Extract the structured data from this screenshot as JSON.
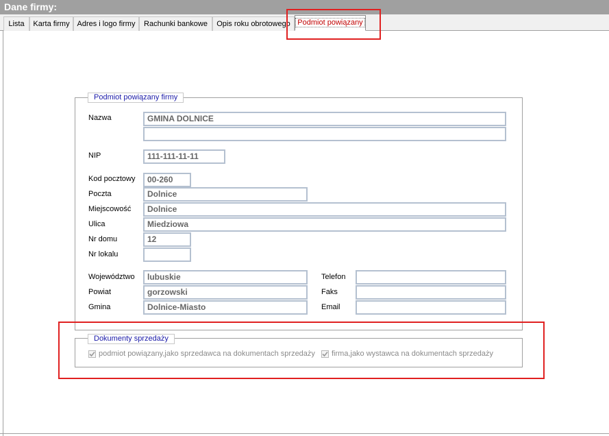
{
  "window": {
    "title": "Dane firmy:"
  },
  "tabs": [
    {
      "label": "Lista"
    },
    {
      "label": "Karta firmy"
    },
    {
      "label": "Adres i logo firmy"
    },
    {
      "label": "Rachunki bankowe"
    },
    {
      "label": "Opis roku obrotowego"
    },
    {
      "label": "Podmiot powiązany",
      "active": true
    }
  ],
  "podmiot": {
    "legend": "Podmiot powiązany firmy",
    "nazwa_label": "Nazwa",
    "nazwa_value": "GMINA DOLNICE",
    "nazwa_value2": "",
    "nip_label": "NIP",
    "nip_value": "111-111-11-11",
    "kod_label": "Kod pocztowy",
    "kod_value": "00-260",
    "poczta_label": "Poczta",
    "poczta_value": "Dolnice",
    "miejscowosc_label": "Miejscowość",
    "miejscowosc_value": "Dolnice",
    "ulica_label": "Ulica",
    "ulica_value": "Miedziowa",
    "nrdomu_label": "Nr domu",
    "nrdomu_value": "12",
    "nrlokalu_label": "Nr lokalu",
    "nrlokalu_value": "",
    "wojewodztwo_label": "Województwo",
    "wojewodztwo_value": "lubuskie",
    "powiat_label": "Powiat",
    "powiat_value": "gorzowski",
    "gmina_label": "Gmina",
    "gmina_value": "Dolnice-Miasto",
    "telefon_label": "Telefon",
    "telefon_value": "",
    "faks_label": "Faks",
    "faks_value": "",
    "email_label": "Email",
    "email_value": ""
  },
  "dokumenty": {
    "legend": "Dokumenty sprzedaży",
    "check1_label": "podmiot powiązany,jako sprzedawca na dokumentach sprzedaży",
    "check1_checked": true,
    "check2_label": "firma,jako wystawca na dokumentach sprzedaży",
    "check2_checked": true
  },
  "colors": {
    "highlight": "#e02020",
    "legend_text": "#1a1aa8",
    "active_tab_text": "#c00000"
  }
}
